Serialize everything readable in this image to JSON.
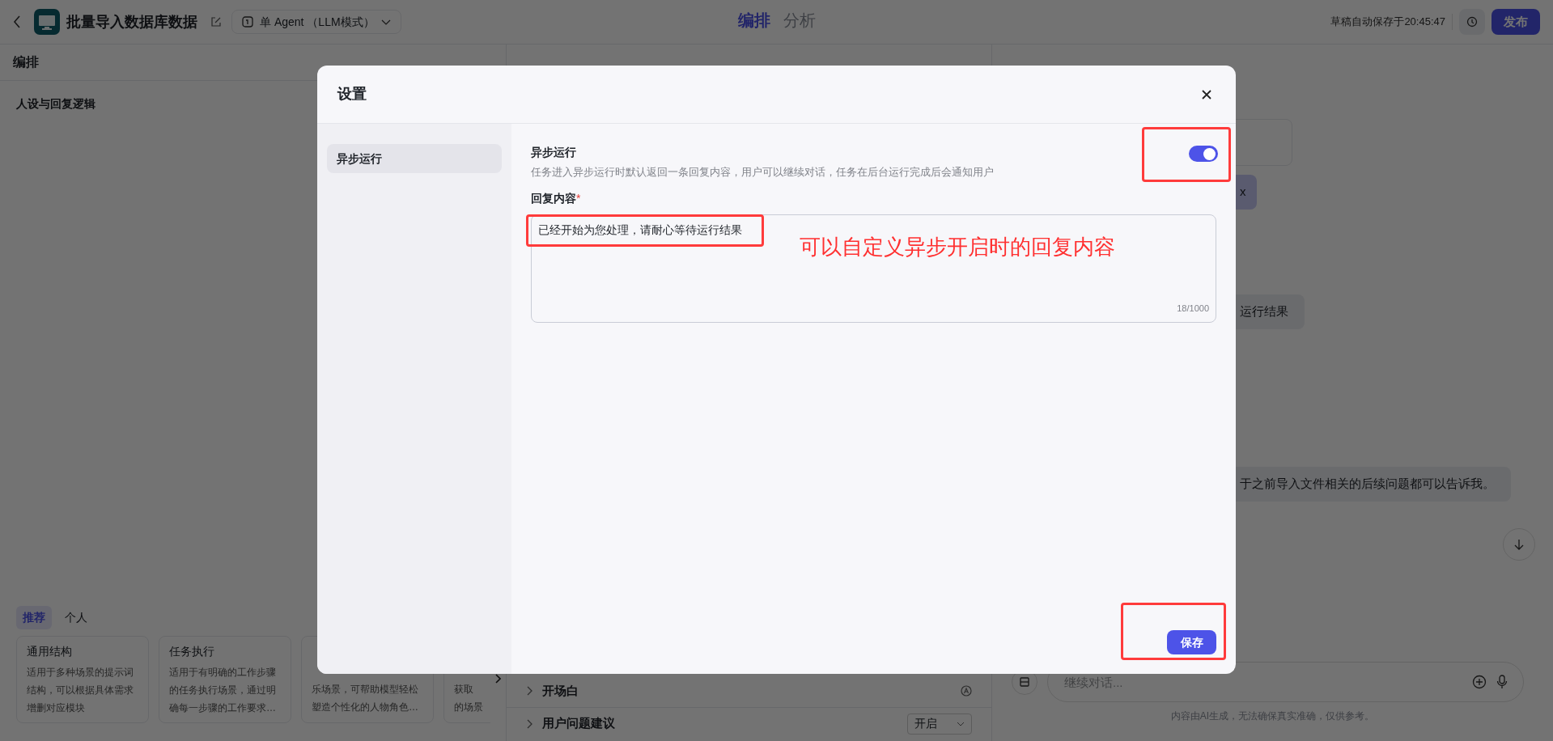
{
  "header": {
    "title": "批量导入数据库数据",
    "mode": "单 Agent （LLM模式）",
    "tabs": [
      {
        "label": "编排",
        "selected": true
      },
      {
        "label": "分析",
        "selected": false
      }
    ],
    "save_status": "草稿自动保存于20:45:47",
    "publish": "发布"
  },
  "left_panel": {
    "title": "编排",
    "section": "人设与回复逻辑",
    "template_tabs": [
      {
        "label": "推荐",
        "selected": true
      },
      {
        "label": "个人",
        "selected": false
      }
    ],
    "cards": [
      {
        "title": "通用结构",
        "lines": [
          "适用于多种场景的提示词",
          "结构，可以根据具体需求",
          "增删对应模块"
        ]
      },
      {
        "title": "任务执行",
        "lines": [
          "适用于有明确的工作步骤",
          "的任务执行场景，通过明",
          "确每一步骤的工作要求…"
        ]
      },
      {
        "lines": [
          "乐场景，可帮助模型轻松",
          "塑造个性化的人物角色…"
        ]
      },
      {
        "lines": [
          "获取",
          "的场景"
        ]
      }
    ]
  },
  "middle_panel": {
    "rows": [
      {
        "label": "开场白",
        "kind": "icon"
      },
      {
        "label": "用户问题建议",
        "kind": "select",
        "value": "开启"
      }
    ]
  },
  "chat": {
    "messages": [
      {
        "kind": "file",
        "text": "x"
      },
      {
        "kind": "text",
        "text": "运行结果"
      },
      {
        "kind": "text",
        "text": "于之前导入文件相关的后续问题都可以告诉我。"
      }
    ],
    "input": {
      "placeholder": "继续对话..."
    },
    "disclaimer": "内容由AI生成，无法确保真实准确，仅供参考。"
  },
  "dialog": {
    "title": "设置",
    "nav": [
      {
        "label": "异步运行",
        "selected": true
      }
    ],
    "setting": {
      "label": "异步运行",
      "description": "任务进入异步运行时默认返回一条回复内容，用户可以继续对话，任务在后台运行完成后会通知用户",
      "on": true
    },
    "reply": {
      "label": "回复内容",
      "required_mark": "*",
      "value": "已经开始为您处理，请耐心等待运行结果",
      "counter": "18/1000"
    },
    "save": "保存"
  },
  "annotation": {
    "note": "可以自定义异步开启时的回复内容"
  }
}
